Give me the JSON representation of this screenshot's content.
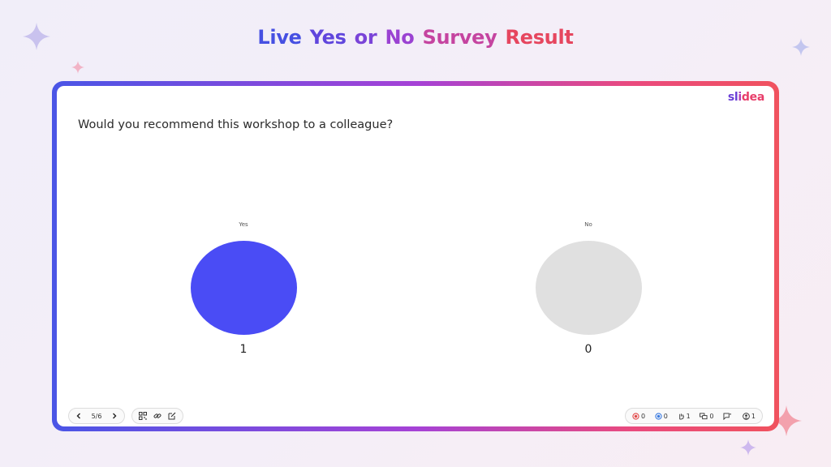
{
  "page": {
    "title_words": [
      {
        "text": "Live",
        "color": "#4650e2"
      },
      {
        "text": "Yes",
        "color": "#6046dd"
      },
      {
        "text": "or",
        "color": "#7a44d8"
      },
      {
        "text": "No",
        "color": "#9a42d2"
      },
      {
        "text": "Survey",
        "color": "#c544a0"
      },
      {
        "text": "Result",
        "color": "#e6465f"
      }
    ]
  },
  "slide": {
    "brand": {
      "sl": "sl",
      "i": "i",
      "dea": "dea"
    },
    "question": "Would you recommend this workshop to a colleague?",
    "options": [
      {
        "label": "Yes",
        "count": "1",
        "color": "#4a4cf5"
      },
      {
        "label": "No",
        "count": "0",
        "color": "#e0e0e0"
      }
    ]
  },
  "toolbar": {
    "page_indicator": "5/6",
    "stats": {
      "red_reactions": "0",
      "blue_reactions": "0",
      "hands": "1",
      "questions": "0",
      "comments": "",
      "participants": "1"
    }
  },
  "colors": {
    "brand_purple": "#6a3fd6",
    "brand_pink": "#e83e6a",
    "yes": "#4a4cf5",
    "no": "#e0e0e0"
  }
}
